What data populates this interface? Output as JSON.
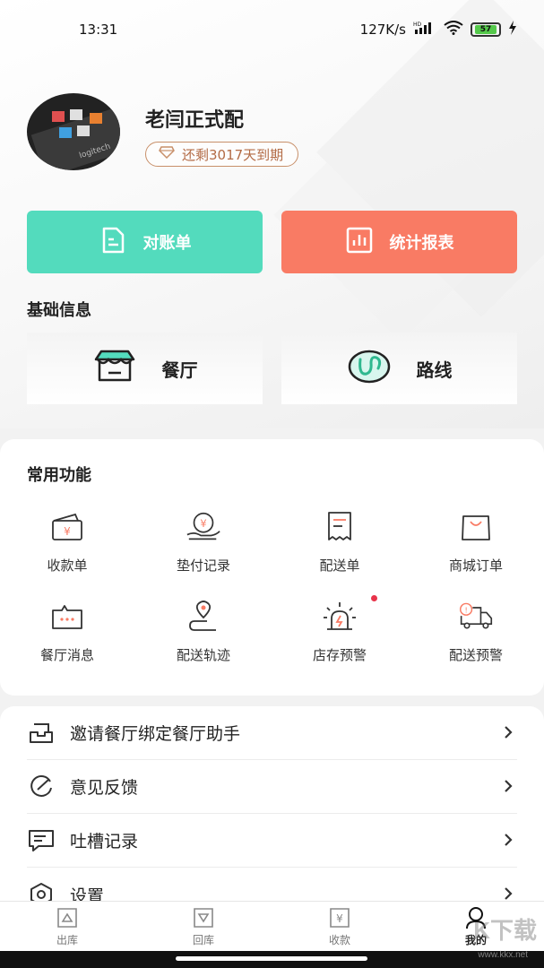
{
  "status_bar": {
    "time": "13:31",
    "network_speed": "127K/s",
    "battery": "57",
    "icons": [
      "hd-signal-icon",
      "wifi-icon",
      "battery-icon",
      "charging-icon"
    ]
  },
  "profile": {
    "name": "老闫正式配",
    "expire_text": "还剩3017天到期",
    "avatar_icon": "avatar"
  },
  "actions": {
    "reconciliation": {
      "label": "对账单",
      "icon": "document-icon",
      "color": "#53dbbd"
    },
    "stats": {
      "label": "统计报表",
      "icon": "bar-chart-icon",
      "color": "#f97b64"
    }
  },
  "basic_info": {
    "title": "基础信息",
    "items": [
      {
        "label": "餐厅",
        "icon": "shop-icon"
      },
      {
        "label": "路线",
        "icon": "route-icon"
      }
    ]
  },
  "common_functions": {
    "title": "常用功能",
    "items": [
      {
        "label": "收款单",
        "icon": "wallet-yuan-icon"
      },
      {
        "label": "垫付记录",
        "icon": "hand-coin-icon"
      },
      {
        "label": "配送单",
        "icon": "receipt-icon"
      },
      {
        "label": "商城订单",
        "icon": "shopping-bag-icon"
      },
      {
        "label": "餐厅消息",
        "icon": "message-icon"
      },
      {
        "label": "配送轨迹",
        "icon": "location-track-icon"
      },
      {
        "label": "店存预警",
        "icon": "alarm-light-icon"
      },
      {
        "label": "配送预警",
        "icon": "truck-alert-icon"
      }
    ]
  },
  "menu_list": [
    {
      "label": "邀请餐厅绑定餐厅助手",
      "icon": "inbox-icon"
    },
    {
      "label": "意见反馈",
      "icon": "feedback-icon"
    },
    {
      "label": "吐槽记录",
      "icon": "comment-icon"
    },
    {
      "label": "设置",
      "icon": "settings-icon"
    }
  ],
  "tab_bar": [
    {
      "label": "出库",
      "icon": "outbound-icon"
    },
    {
      "label": "回库",
      "icon": "inbound-icon"
    },
    {
      "label": "收款",
      "icon": "collect-icon"
    },
    {
      "label": "我的",
      "icon": "profile-icon",
      "active": true
    }
  ],
  "watermark": {
    "text": "K下载",
    "sub": "www.kkx.net"
  },
  "colors": {
    "accent_green": "#53dbbd",
    "accent_orange": "#f97b64",
    "badge_brown": "#b36b45",
    "notification_red": "#e8334a"
  }
}
